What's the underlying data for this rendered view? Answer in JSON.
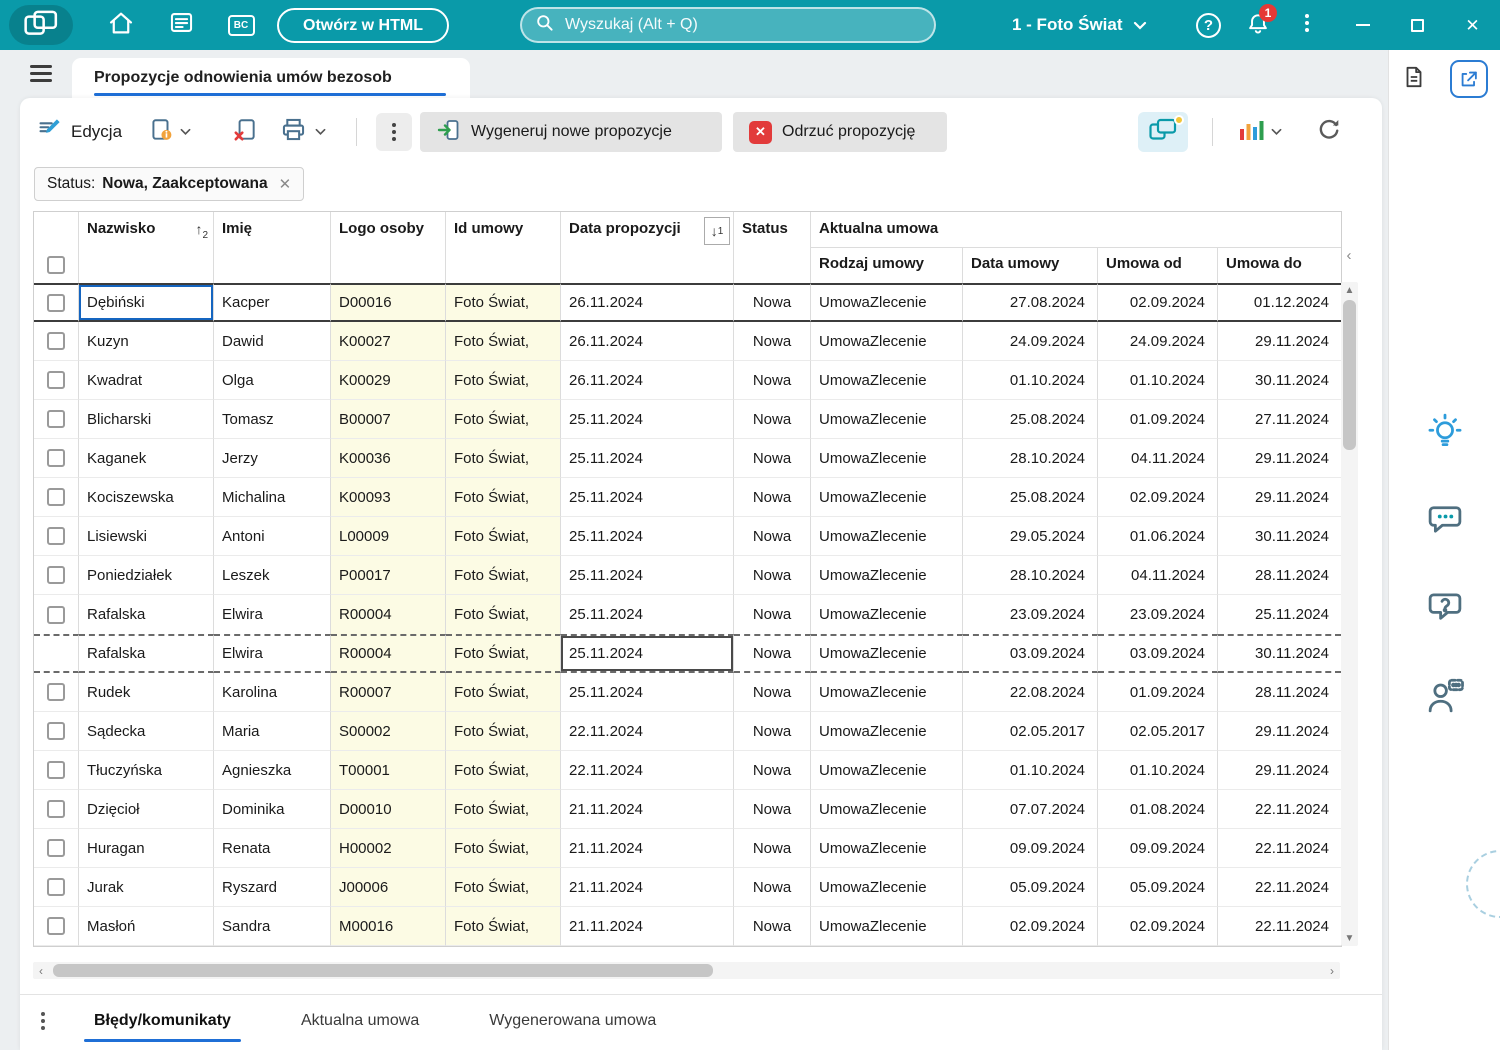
{
  "topbar": {
    "open_html": "Otwórz w HTML",
    "search_placeholder": "Wyszukaj (Alt + Q)",
    "company": "1 - Foto Świat",
    "notification_count": "1"
  },
  "tab": {
    "title": "Propozycje odnowienia umów bezosob"
  },
  "toolbar": {
    "edit": "Edycja",
    "generate": "Wygeneruj nowe propozycje",
    "reject": "Odrzuć propozycję"
  },
  "filter": {
    "label": "Status:",
    "value": "Nowa, Zaakceptowana"
  },
  "table": {
    "headers": {
      "nazwisko": "Nazwisko",
      "imie": "Imię",
      "logo": "Logo osoby",
      "id_umowy": "Id umowy",
      "data_propozycji": "Data propozycji",
      "status": "Status",
      "aktualna": "Aktualna umowa",
      "rodzaj": "Rodzaj umowy",
      "data_umowy": "Data umowy",
      "umowa_od": "Umowa od",
      "umowa_do": "Umowa do"
    },
    "sort": {
      "nazwisko": {
        "arrow": "↑",
        "order": "2"
      },
      "data_propozycji": {
        "arrow": "↓",
        "order": "1"
      }
    },
    "rows": [
      {
        "state": "selected",
        "nazwisko": "Dębiński",
        "imie": "Kacper",
        "logo": "D00016",
        "id_umowy": "Foto Świat,",
        "data_propozycji": "26.11.2024",
        "status": "Nowa",
        "rodzaj": "UmowaZlecenie",
        "data_umowy": "27.08.2024",
        "umowa_od": "02.09.2024",
        "umowa_do": "01.12.2024"
      },
      {
        "nazwisko": "Kuzyn",
        "imie": "Dawid",
        "logo": "K00027",
        "id_umowy": "Foto Świat,",
        "data_propozycji": "26.11.2024",
        "status": "Nowa",
        "rodzaj": "UmowaZlecenie",
        "data_umowy": "24.09.2024",
        "umowa_od": "24.09.2024",
        "umowa_do": "29.11.2024"
      },
      {
        "nazwisko": "Kwadrat",
        "imie": "Olga",
        "logo": "K00029",
        "id_umowy": "Foto Świat,",
        "data_propozycji": "26.11.2024",
        "status": "Nowa",
        "rodzaj": "UmowaZlecenie",
        "data_umowy": "01.10.2024",
        "umowa_od": "01.10.2024",
        "umowa_do": "30.11.2024"
      },
      {
        "nazwisko": "Blicharski",
        "imie": "Tomasz",
        "logo": "B00007",
        "id_umowy": "Foto Świat,",
        "data_propozycji": "25.11.2024",
        "status": "Nowa",
        "rodzaj": "UmowaZlecenie",
        "data_umowy": "25.08.2024",
        "umowa_od": "01.09.2024",
        "umowa_do": "27.11.2024"
      },
      {
        "nazwisko": "Kaganek",
        "imie": "Jerzy",
        "logo": "K00036",
        "id_umowy": "Foto Świat,",
        "data_propozycji": "25.11.2024",
        "status": "Nowa",
        "rodzaj": "UmowaZlecenie",
        "data_umowy": "28.10.2024",
        "umowa_od": "04.11.2024",
        "umowa_do": "29.11.2024"
      },
      {
        "nazwisko": "Kociszewska",
        "imie": "Michalina",
        "logo": "K00093",
        "id_umowy": "Foto Świat,",
        "data_propozycji": "25.11.2024",
        "status": "Nowa",
        "rodzaj": "UmowaZlecenie",
        "data_umowy": "25.08.2024",
        "umowa_od": "02.09.2024",
        "umowa_do": "29.11.2024"
      },
      {
        "nazwisko": "Lisiewski",
        "imie": "Antoni",
        "logo": "L00009",
        "id_umowy": "Foto Świat,",
        "data_propozycji": "25.11.2024",
        "status": "Nowa",
        "rodzaj": "UmowaZlecenie",
        "data_umowy": "29.05.2024",
        "umowa_od": "01.06.2024",
        "umowa_do": "30.11.2024"
      },
      {
        "nazwisko": "Poniedziałek",
        "imie": "Leszek",
        "logo": "P00017",
        "id_umowy": "Foto Świat,",
        "data_propozycji": "25.11.2024",
        "status": "Nowa",
        "rodzaj": "UmowaZlecenie",
        "data_umowy": "28.10.2024",
        "umowa_od": "04.11.2024",
        "umowa_do": "28.11.2024"
      },
      {
        "nazwisko": "Rafalska",
        "imie": "Elwira",
        "logo": "R00004",
        "id_umowy": "Foto Świat,",
        "data_propozycji": "25.11.2024",
        "status": "Nowa",
        "rodzaj": "UmowaZlecenie",
        "data_umowy": "23.09.2024",
        "umowa_od": "23.09.2024",
        "umowa_do": "25.11.2024"
      },
      {
        "state": "marked",
        "no_checkbox": true,
        "nazwisko": "Rafalska",
        "imie": "Elwira",
        "logo": "R00004",
        "id_umowy": "Foto Świat,",
        "data_propozycji": "25.11.2024",
        "status": "Nowa",
        "rodzaj": "UmowaZlecenie",
        "data_umowy": "03.09.2024",
        "umowa_od": "03.09.2024",
        "umowa_do": "30.11.2024"
      },
      {
        "nazwisko": "Rudek",
        "imie": "Karolina",
        "logo": "R00007",
        "id_umowy": "Foto Świat,",
        "data_propozycji": "25.11.2024",
        "status": "Nowa",
        "rodzaj": "UmowaZlecenie",
        "data_umowy": "22.08.2024",
        "umowa_od": "01.09.2024",
        "umowa_do": "28.11.2024"
      },
      {
        "nazwisko": "Sądecka",
        "imie": "Maria",
        "logo": "S00002",
        "id_umowy": "Foto Świat,",
        "data_propozycji": "22.11.2024",
        "status": "Nowa",
        "rodzaj": "UmowaZlecenie",
        "data_umowy": "02.05.2017",
        "umowa_od": "02.05.2017",
        "umowa_do": "29.11.2024"
      },
      {
        "nazwisko": "Tłuczyńska",
        "imie": "Agnieszka",
        "logo": "T00001",
        "id_umowy": "Foto Świat,",
        "data_propozycji": "22.11.2024",
        "status": "Nowa",
        "rodzaj": "UmowaZlecenie",
        "data_umowy": "01.10.2024",
        "umowa_od": "01.10.2024",
        "umowa_do": "29.11.2024"
      },
      {
        "nazwisko": "Dzięcioł",
        "imie": "Dominika",
        "logo": "D00010",
        "id_umowy": "Foto Świat,",
        "data_propozycji": "21.11.2024",
        "status": "Nowa",
        "rodzaj": "UmowaZlecenie",
        "data_umowy": "07.07.2024",
        "umowa_od": "01.08.2024",
        "umowa_do": "22.11.2024"
      },
      {
        "nazwisko": "Huragan",
        "imie": "Renata",
        "logo": "H00002",
        "id_umowy": "Foto Świat,",
        "data_propozycji": "21.11.2024",
        "status": "Nowa",
        "rodzaj": "UmowaZlecenie",
        "data_umowy": "09.09.2024",
        "umowa_od": "09.09.2024",
        "umowa_do": "22.11.2024"
      },
      {
        "nazwisko": "Jurak",
        "imie": "Ryszard",
        "logo": "J00006",
        "id_umowy": "Foto Świat,",
        "data_propozycji": "21.11.2024",
        "status": "Nowa",
        "rodzaj": "UmowaZlecenie",
        "data_umowy": "05.09.2024",
        "umowa_od": "05.09.2024",
        "umowa_do": "22.11.2024"
      },
      {
        "nazwisko": "Masłoń",
        "imie": "Sandra",
        "logo": "M00016",
        "id_umowy": "Foto Świat,",
        "data_propozycji": "21.11.2024",
        "status": "Nowa",
        "rodzaj": "UmowaZlecenie",
        "data_umowy": "02.09.2024",
        "umowa_od": "02.09.2024",
        "umowa_do": "22.11.2024"
      }
    ]
  },
  "bottom_tabs": [
    {
      "label": "Błędy/komunikaty",
      "active": true
    },
    {
      "label": "Aktualna umowa",
      "active": false
    },
    {
      "label": "Wygenerowana umowa",
      "active": false
    }
  ],
  "colors": {
    "topbar_teal": "#0a9aa9",
    "accent_blue": "#1f6fd6",
    "badge_red": "#e53935",
    "highlight_yellow": "#fcfbe4"
  }
}
